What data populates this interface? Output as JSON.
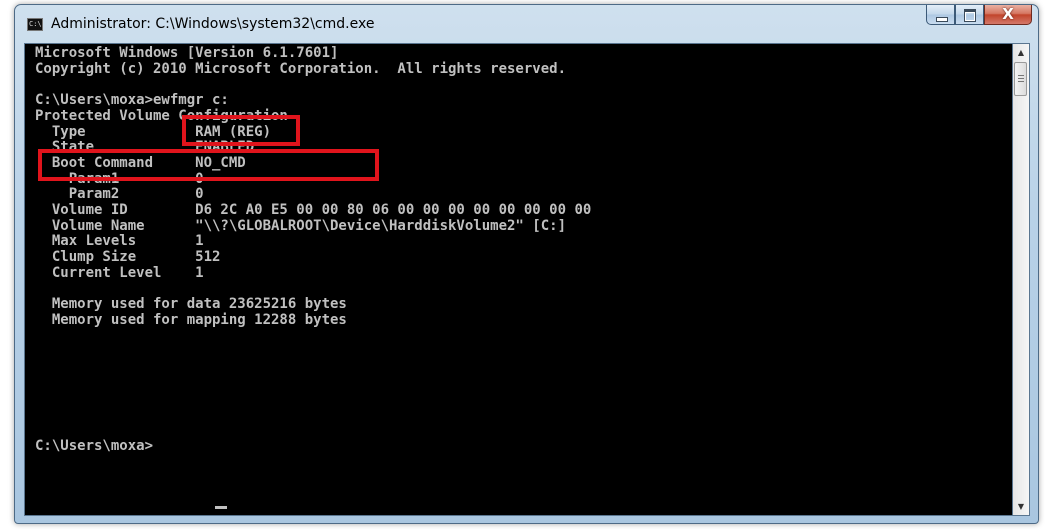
{
  "window": {
    "title": "Administrator: C:\\Windows\\system32\\cmd.exe",
    "app_icon_text": "C:\\",
    "close_glyph": "X"
  },
  "console": {
    "lines": [
      "Microsoft Windows [Version 6.1.7601]",
      "Copyright (c) 2010 Microsoft Corporation.  All rights reserved.",
      "",
      "C:\\Users\\moxa>ewfmgr c:",
      "Protected Volume Configuration",
      "  Type             RAM (REG)",
      "  State            ENABLED",
      "  Boot Command     NO_CMD",
      "    Param1         0",
      "    Param2         0",
      "  Volume ID        D6 2C A0 E5 00 00 80 06 00 00 00 00 00 00 00 00",
      "  Volume Name      \"\\\\?\\GLOBALROOT\\Device\\HarddiskVolume2\" [C:]",
      "  Max Levels       1",
      "  Clump Size       512",
      "  Current Level    1",
      "",
      "  Memory used for data 23625216 bytes",
      "  Memory used for mapping 12288 bytes",
      "",
      "",
      "",
      "",
      "",
      "",
      "",
      "C:\\Users\\moxa>"
    ]
  },
  "scrollbar": {
    "up_arrow": "▲",
    "down_arrow": "▼"
  },
  "colors": {
    "console_text": "#c0c0c0",
    "console_bg": "#000000",
    "highlight": "#e0141c"
  }
}
